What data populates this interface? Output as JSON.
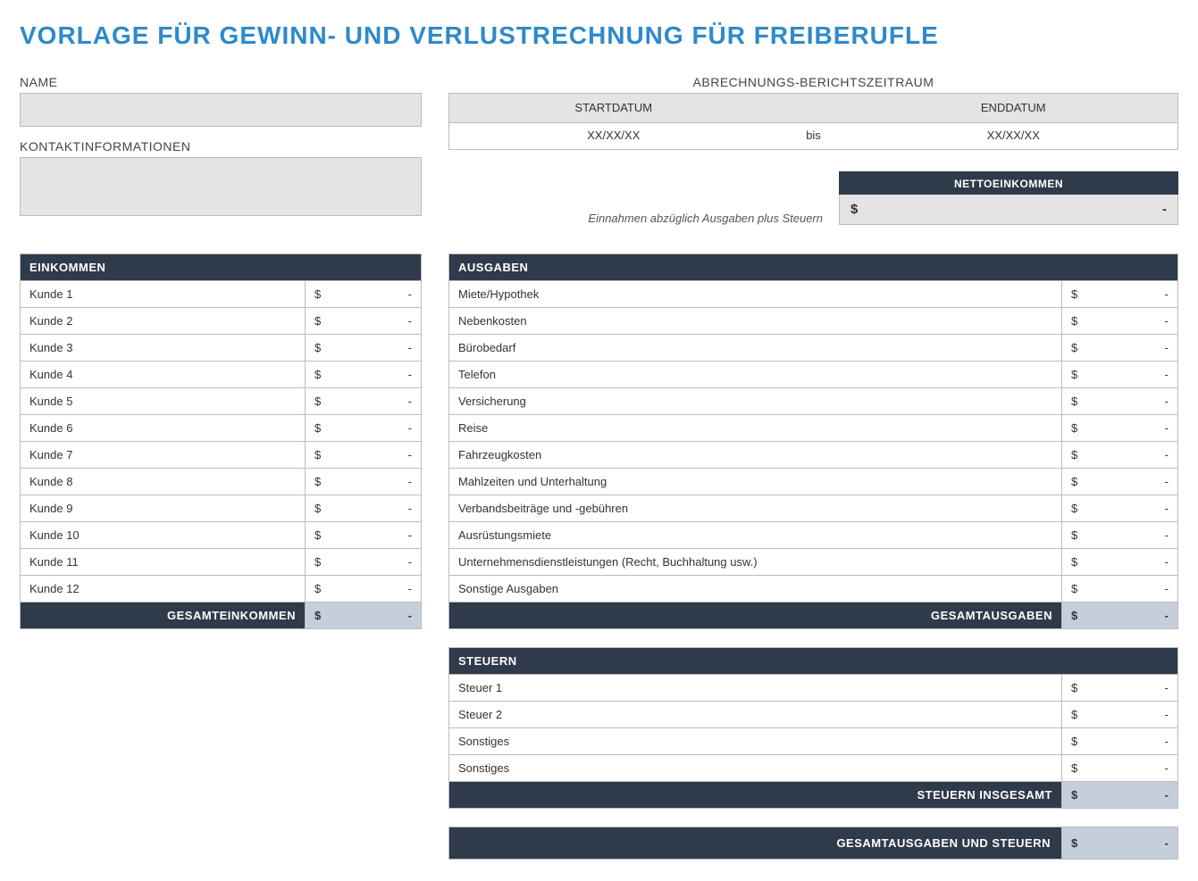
{
  "title": "VORLAGE FÜR GEWINN- UND VERLUSTRECHNUNG FÜR FREIBERUFLE",
  "labels": {
    "name": "NAME",
    "contact": "KONTAKTINFORMATIONEN",
    "period": "ABRECHNUNGS-BERICHTSZEITRAUM",
    "start_date": "STARTDATUM",
    "end_date": "ENDDATUM",
    "to": "bis",
    "net_income": "NETTOEINKOMMEN",
    "net_income_note": "Einnahmen abzüglich Ausgaben plus Steuern"
  },
  "values": {
    "name": "",
    "contact": "",
    "start_date": "XX/XX/XX",
    "end_date": "XX/XX/XX",
    "net_income": "-",
    "currency": "$"
  },
  "income": {
    "header": "EINKOMMEN",
    "total_label": "GESAMTEINKOMMEN",
    "total_value": "-",
    "rows": [
      {
        "label": "Kunde 1",
        "value": "-"
      },
      {
        "label": "Kunde 2",
        "value": "-"
      },
      {
        "label": "Kunde 3",
        "value": "-"
      },
      {
        "label": "Kunde 4",
        "value": "-"
      },
      {
        "label": "Kunde 5",
        "value": "-"
      },
      {
        "label": "Kunde 6",
        "value": "-"
      },
      {
        "label": "Kunde 7",
        "value": "-"
      },
      {
        "label": "Kunde 8",
        "value": "-"
      },
      {
        "label": "Kunde 9",
        "value": "-"
      },
      {
        "label": "Kunde 10",
        "value": "-"
      },
      {
        "label": "Kunde 11",
        "value": "-"
      },
      {
        "label": "Kunde 12",
        "value": "-"
      }
    ]
  },
  "expenses": {
    "header": "AUSGABEN",
    "total_label": "GESAMTAUSGABEN",
    "total_value": "-",
    "rows": [
      {
        "label": "Miete/Hypothek",
        "value": "-"
      },
      {
        "label": "Nebenkosten",
        "value": "-"
      },
      {
        "label": "Bürobedarf",
        "value": "-"
      },
      {
        "label": "Telefon",
        "value": "-"
      },
      {
        "label": "Versicherung",
        "value": "-"
      },
      {
        "label": "Reise",
        "value": "-"
      },
      {
        "label": "Fahrzeugkosten",
        "value": "-"
      },
      {
        "label": "Mahlzeiten und Unterhaltung",
        "value": "-"
      },
      {
        "label": "Verbandsbeiträge und -gebühren",
        "value": "-"
      },
      {
        "label": "Ausrüstungsmiete",
        "value": "-"
      },
      {
        "label": "Unternehmensdienstleistungen (Recht, Buchhaltung usw.)",
        "value": "-"
      },
      {
        "label": "Sonstige Ausgaben",
        "value": "-"
      }
    ]
  },
  "taxes": {
    "header": "STEUERN",
    "total_label": "STEUERN INSGESAMT",
    "total_value": "-",
    "rows": [
      {
        "label": "Steuer 1",
        "value": "-"
      },
      {
        "label": "Steuer 2",
        "value": "-"
      },
      {
        "label": "Sonstiges",
        "value": "-"
      },
      {
        "label": "Sonstiges",
        "value": "-"
      }
    ]
  },
  "grand_total": {
    "label": "GESAMTAUSGABEN UND STEUERN",
    "value": "-"
  }
}
